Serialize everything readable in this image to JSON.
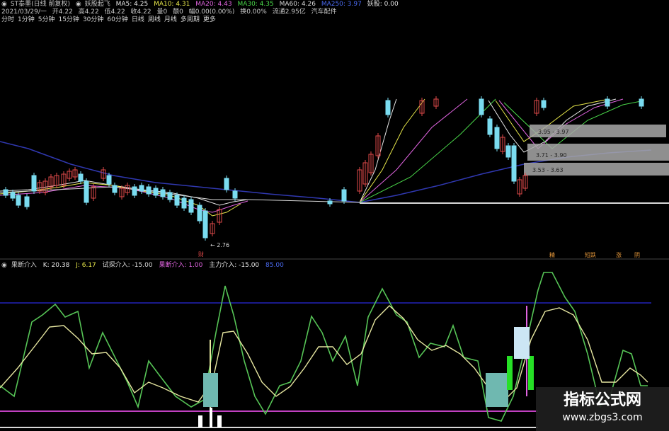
{
  "header": {
    "row1": {
      "icon": "record-icon",
      "stock": "ST泰墨(日线 前复权)",
      "icon2": "record-icon",
      "indicator": "妖股起飞",
      "ma5": "MA5: 4.25",
      "ma10": "MA10: 4.31",
      "ma20": "MA20: 4.43",
      "ma30": "MA30: 4.35",
      "ma60": "MA60: 4.26",
      "ma250": "MA250: 3.97",
      "warn": "妖股: 0.00"
    },
    "row2": {
      "date": "2021/03/29/一",
      "open": "开4.22",
      "high": "高4.22",
      "low": "低4.22",
      "close": "收4.22",
      "vol": "量0",
      "amount": "额0",
      "change": "幅0.00(0.00%)",
      "turnover": "换0.00%",
      "float": "流通2.95亿",
      "industry": "汽车配件"
    },
    "tabs": [
      "分时",
      "1分钟",
      "5分钟",
      "15分钟",
      "30分钟",
      "60分钟",
      "日线",
      "周线",
      "月线",
      "多周期",
      "更多"
    ]
  },
  "upper_chart": {
    "low_label": "2.76",
    "boxes": [
      "3.95 - 3.97",
      "3.71 - 3.90",
      "3.53 - 3.63"
    ],
    "signals": [
      "精",
      "短跌",
      "涨",
      "阴"
    ],
    "marker": "财"
  },
  "lower_header": {
    "icon": "record-icon",
    "name": "果断介入",
    "k": "K: 20.38",
    "j": "J: 6.17",
    "try": "试探介入: -15.00",
    "fruit": "果断介入: 1.00",
    "main": "主力介入: -15.00",
    "blue": "85.00"
  },
  "watermark": {
    "title": "指标公式网",
    "url": "www.zbgs3.com"
  },
  "colors": {
    "bg": "#000000",
    "candle_up": "#e04a4a",
    "candle_down": "#7adcf0",
    "k_line": "#56c456",
    "d_line": "#e6e6a0"
  }
}
